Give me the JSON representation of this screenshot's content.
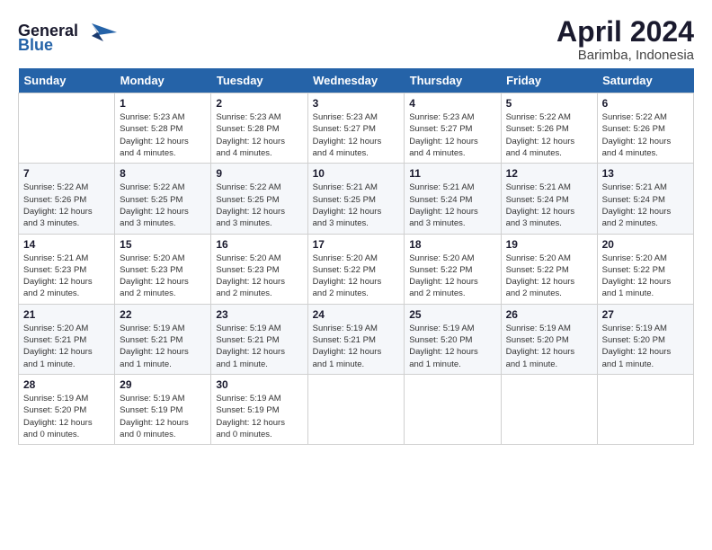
{
  "header": {
    "logo_line1": "General",
    "logo_line2": "Blue",
    "month": "April 2024",
    "location": "Barimba, Indonesia"
  },
  "days_of_week": [
    "Sunday",
    "Monday",
    "Tuesday",
    "Wednesday",
    "Thursday",
    "Friday",
    "Saturday"
  ],
  "weeks": [
    [
      {
        "day": "",
        "info": ""
      },
      {
        "day": "1",
        "info": "Sunrise: 5:23 AM\nSunset: 5:28 PM\nDaylight: 12 hours\nand 4 minutes."
      },
      {
        "day": "2",
        "info": "Sunrise: 5:23 AM\nSunset: 5:28 PM\nDaylight: 12 hours\nand 4 minutes."
      },
      {
        "day": "3",
        "info": "Sunrise: 5:23 AM\nSunset: 5:27 PM\nDaylight: 12 hours\nand 4 minutes."
      },
      {
        "day": "4",
        "info": "Sunrise: 5:23 AM\nSunset: 5:27 PM\nDaylight: 12 hours\nand 4 minutes."
      },
      {
        "day": "5",
        "info": "Sunrise: 5:22 AM\nSunset: 5:26 PM\nDaylight: 12 hours\nand 4 minutes."
      },
      {
        "day": "6",
        "info": "Sunrise: 5:22 AM\nSunset: 5:26 PM\nDaylight: 12 hours\nand 4 minutes."
      }
    ],
    [
      {
        "day": "7",
        "info": "Sunrise: 5:22 AM\nSunset: 5:26 PM\nDaylight: 12 hours\nand 3 minutes."
      },
      {
        "day": "8",
        "info": "Sunrise: 5:22 AM\nSunset: 5:25 PM\nDaylight: 12 hours\nand 3 minutes."
      },
      {
        "day": "9",
        "info": "Sunrise: 5:22 AM\nSunset: 5:25 PM\nDaylight: 12 hours\nand 3 minutes."
      },
      {
        "day": "10",
        "info": "Sunrise: 5:21 AM\nSunset: 5:25 PM\nDaylight: 12 hours\nand 3 minutes."
      },
      {
        "day": "11",
        "info": "Sunrise: 5:21 AM\nSunset: 5:24 PM\nDaylight: 12 hours\nand 3 minutes."
      },
      {
        "day": "12",
        "info": "Sunrise: 5:21 AM\nSunset: 5:24 PM\nDaylight: 12 hours\nand 3 minutes."
      },
      {
        "day": "13",
        "info": "Sunrise: 5:21 AM\nSunset: 5:24 PM\nDaylight: 12 hours\nand 2 minutes."
      }
    ],
    [
      {
        "day": "14",
        "info": "Sunrise: 5:21 AM\nSunset: 5:23 PM\nDaylight: 12 hours\nand 2 minutes."
      },
      {
        "day": "15",
        "info": "Sunrise: 5:20 AM\nSunset: 5:23 PM\nDaylight: 12 hours\nand 2 minutes."
      },
      {
        "day": "16",
        "info": "Sunrise: 5:20 AM\nSunset: 5:23 PM\nDaylight: 12 hours\nand 2 minutes."
      },
      {
        "day": "17",
        "info": "Sunrise: 5:20 AM\nSunset: 5:22 PM\nDaylight: 12 hours\nand 2 minutes."
      },
      {
        "day": "18",
        "info": "Sunrise: 5:20 AM\nSunset: 5:22 PM\nDaylight: 12 hours\nand 2 minutes."
      },
      {
        "day": "19",
        "info": "Sunrise: 5:20 AM\nSunset: 5:22 PM\nDaylight: 12 hours\nand 2 minutes."
      },
      {
        "day": "20",
        "info": "Sunrise: 5:20 AM\nSunset: 5:22 PM\nDaylight: 12 hours\nand 1 minute."
      }
    ],
    [
      {
        "day": "21",
        "info": "Sunrise: 5:20 AM\nSunset: 5:21 PM\nDaylight: 12 hours\nand 1 minute."
      },
      {
        "day": "22",
        "info": "Sunrise: 5:19 AM\nSunset: 5:21 PM\nDaylight: 12 hours\nand 1 minute."
      },
      {
        "day": "23",
        "info": "Sunrise: 5:19 AM\nSunset: 5:21 PM\nDaylight: 12 hours\nand 1 minute."
      },
      {
        "day": "24",
        "info": "Sunrise: 5:19 AM\nSunset: 5:21 PM\nDaylight: 12 hours\nand 1 minute."
      },
      {
        "day": "25",
        "info": "Sunrise: 5:19 AM\nSunset: 5:20 PM\nDaylight: 12 hours\nand 1 minute."
      },
      {
        "day": "26",
        "info": "Sunrise: 5:19 AM\nSunset: 5:20 PM\nDaylight: 12 hours\nand 1 minute."
      },
      {
        "day": "27",
        "info": "Sunrise: 5:19 AM\nSunset: 5:20 PM\nDaylight: 12 hours\nand 1 minute."
      }
    ],
    [
      {
        "day": "28",
        "info": "Sunrise: 5:19 AM\nSunset: 5:20 PM\nDaylight: 12 hours\nand 0 minutes."
      },
      {
        "day": "29",
        "info": "Sunrise: 5:19 AM\nSunset: 5:19 PM\nDaylight: 12 hours\nand 0 minutes."
      },
      {
        "day": "30",
        "info": "Sunrise: 5:19 AM\nSunset: 5:19 PM\nDaylight: 12 hours\nand 0 minutes."
      },
      {
        "day": "",
        "info": ""
      },
      {
        "day": "",
        "info": ""
      },
      {
        "day": "",
        "info": ""
      },
      {
        "day": "",
        "info": ""
      }
    ]
  ]
}
